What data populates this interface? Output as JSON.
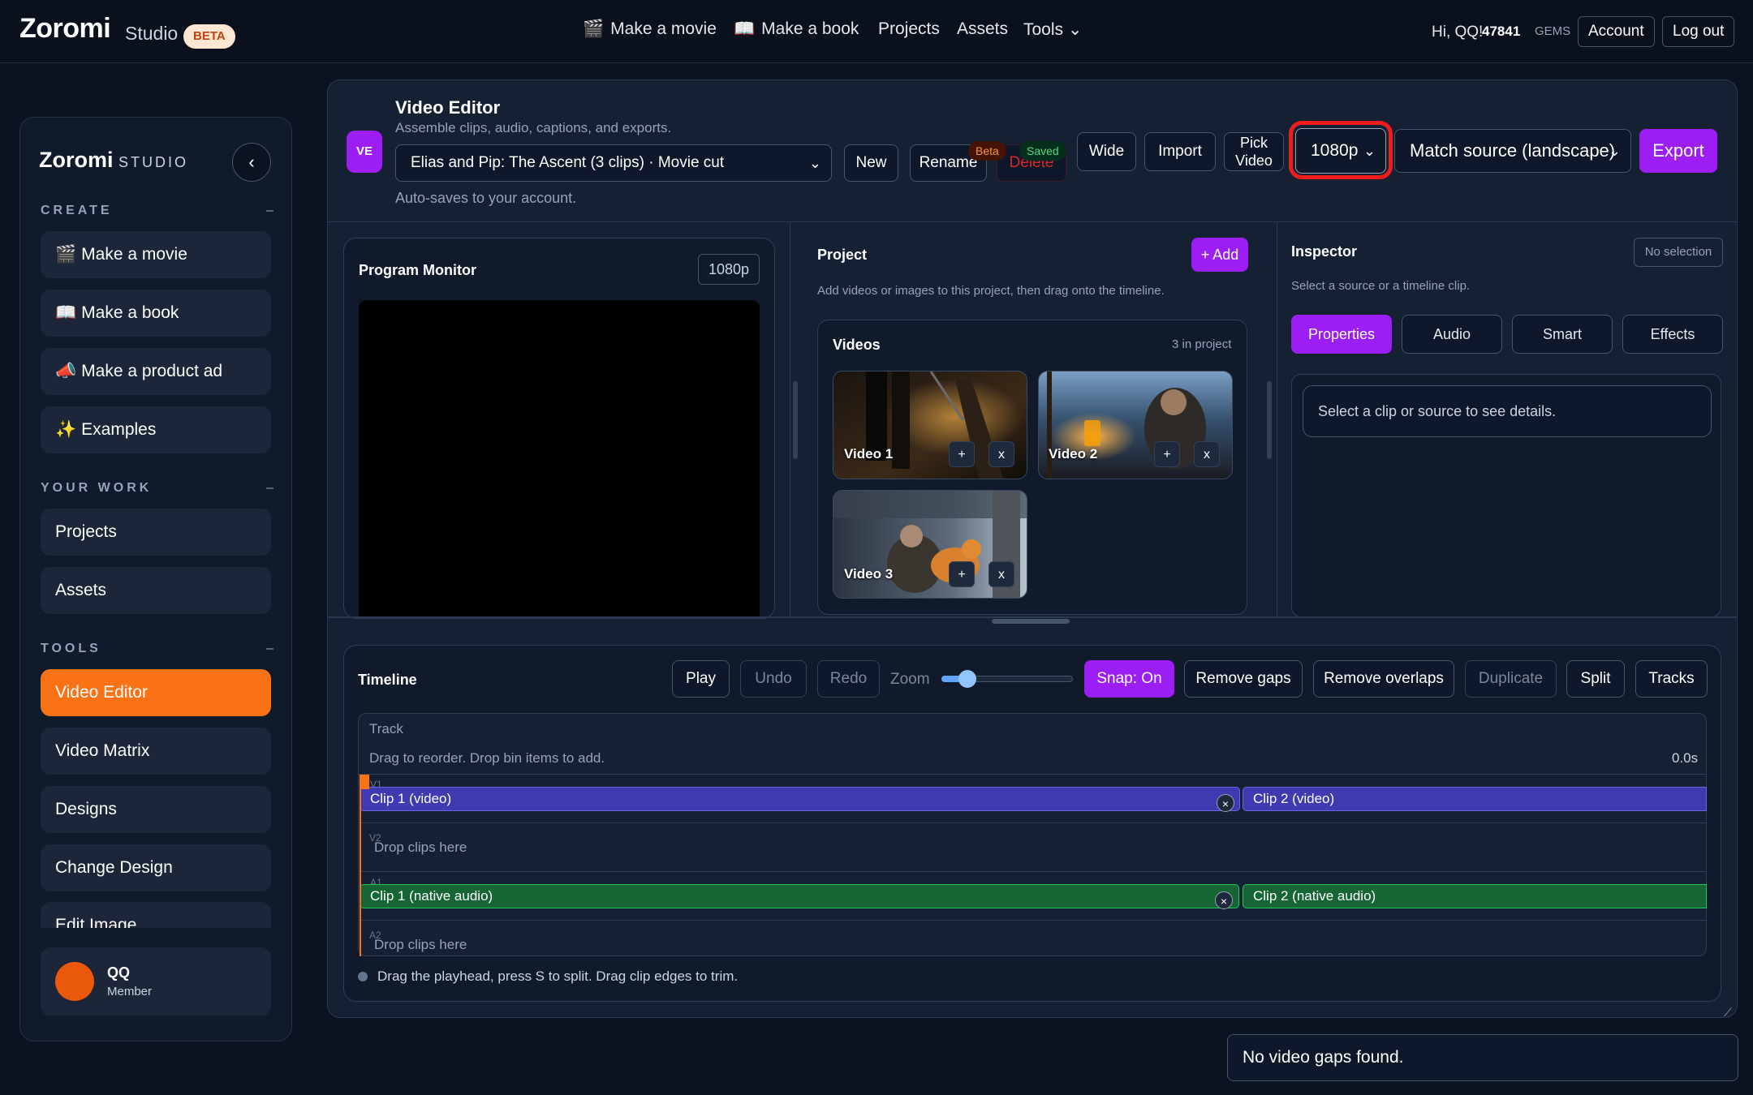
{
  "topbar": {
    "brand": "Zoromi",
    "brand_sub": "Studio",
    "beta": "BETA",
    "nav": [
      {
        "emoji": "🎬",
        "label": "Make a movie"
      },
      {
        "emoji": "📖",
        "label": "Make a book"
      },
      {
        "emoji": "",
        "label": "Projects"
      },
      {
        "emoji": "",
        "label": "Assets"
      },
      {
        "emoji": "",
        "label": "Tools ⌄"
      }
    ],
    "greeting": "Hi, QQ!",
    "gems_value": "47841",
    "gems_unit": "GEMS",
    "account": "Account",
    "logout": "Log out"
  },
  "sidebar": {
    "brand": "Zoromi",
    "brand_sub": "STUDIO",
    "collapse_glyph": "‹",
    "sections": {
      "create": "CREATE",
      "your_work": "YOUR WORK",
      "tools": "TOOLS",
      "dash": "–"
    },
    "create_items": [
      {
        "emoji": "🎬",
        "label": "Make a movie"
      },
      {
        "emoji": "📖",
        "label": "Make a book"
      },
      {
        "emoji": "📣",
        "label": "Make a product ad"
      },
      {
        "emoji": "✨",
        "label": "Examples"
      }
    ],
    "work_items": [
      "Projects",
      "Assets"
    ],
    "tool_items": [
      "Video Editor",
      "Video Matrix",
      "Designs",
      "Change Design",
      "Edit Image"
    ],
    "user": {
      "name": "QQ",
      "role": "Member"
    }
  },
  "editor": {
    "badge": "VE",
    "title": "Video Editor",
    "subtitle": "Assemble clips, audio, captions, and exports.",
    "project_select": "Elias and Pip: The Ascent (3 clips) · Movie cut",
    "autosave": "Auto-saves to your account.",
    "buttons": {
      "new": "New",
      "rename": "Rename",
      "delete": "Delete",
      "wide": "Wide",
      "import": "Import",
      "pick_video_line1": "Pick",
      "pick_video_line2": "Video",
      "export": "Export"
    },
    "tag_beta": "Beta",
    "tag_saved": "Saved",
    "resolution": "1080p",
    "aspect": "Match source (landscape)",
    "chevron": "⌄"
  },
  "monitor": {
    "title": "Program Monitor",
    "resolution": "1080p"
  },
  "project": {
    "title": "Project",
    "add": "+ Add",
    "hint": "Add videos or images to this project, then drag onto the timeline.",
    "videos_title": "Videos",
    "videos_count": "3 in project",
    "videos": [
      {
        "label": "Video 1",
        "add": "+",
        "remove": "x"
      },
      {
        "label": "Video 2",
        "add": "+",
        "remove": "x"
      },
      {
        "label": "Video 3",
        "add": "+",
        "remove": "x"
      }
    ]
  },
  "inspector": {
    "title": "Inspector",
    "no_selection": "No selection",
    "hint": "Select a source or a timeline clip.",
    "tabs": [
      "Properties",
      "Audio",
      "Smart",
      "Effects"
    ],
    "message": "Select a clip or source to see details."
  },
  "timeline": {
    "title": "Timeline",
    "buttons": {
      "play": "Play",
      "undo": "Undo",
      "redo": "Redo",
      "zoom": "Zoom",
      "snap": "Snap: On",
      "remove_gaps": "Remove gaps",
      "remove_overlaps": "Remove overlaps",
      "duplicate": "Duplicate",
      "split": "Split",
      "tracks": "Tracks"
    },
    "zoom_level": 0.2,
    "track_label": "Track",
    "track_hint": "Drag to reorder. Drop bin items to add.",
    "time": "0.0s",
    "tracks": {
      "v1": "V1",
      "v2": "V2",
      "a1": "A1",
      "a2": "A2"
    },
    "clips": {
      "v1_clip1": "Clip 1 (video)",
      "v1_clip2": "Clip 2 (video)",
      "a1_clip1": "Clip 1 (native audio)",
      "a1_clip2": "Clip 2 (native audio)",
      "remove": "×"
    },
    "drop_hint": "Drop clips here",
    "help": "Drag the playhead, press S to split. Drag clip edges to trim."
  },
  "toast": "No video gaps found.",
  "colors": {
    "accent_purple": "#9d1ef5",
    "accent_orange": "#f97316",
    "highlight_red": "#ef1c1c",
    "video_clip": "#3f3ab0",
    "audio_clip": "#166534"
  }
}
